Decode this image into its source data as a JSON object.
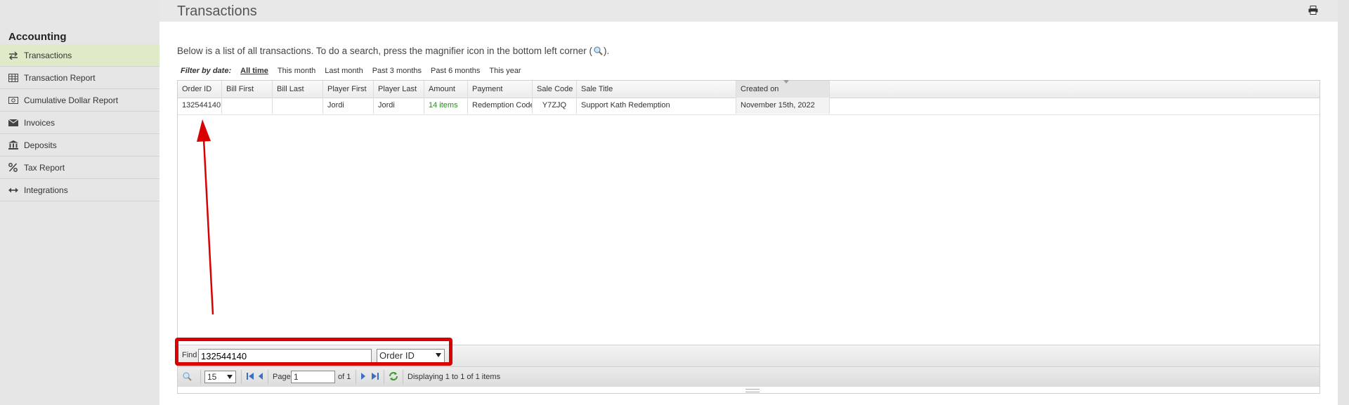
{
  "sidebar": {
    "heading": "Accounting",
    "items": [
      {
        "label": "Transactions",
        "icon": "arrows-exchange-icon",
        "active": true
      },
      {
        "label": "Transaction Report",
        "icon": "table-icon"
      },
      {
        "label": "Cumulative Dollar Report",
        "icon": "money-icon"
      },
      {
        "label": "Invoices",
        "icon": "envelope-icon"
      },
      {
        "label": "Deposits",
        "icon": "bank-icon"
      },
      {
        "label": "Tax Report",
        "icon": "percent-icon"
      },
      {
        "label": "Integrations",
        "icon": "arrows-horizontal-icon"
      }
    ]
  },
  "header": {
    "title": "Transactions",
    "print_icon": "print-icon"
  },
  "intro": {
    "text_before": "Below is a list of all transactions. To do a search, press the magnifier icon in the bottom left corner (",
    "text_after": ")."
  },
  "filter": {
    "label": "Filter by date:",
    "options": [
      "All time",
      "This month",
      "Last month",
      "Past 3 months",
      "Past 6 months",
      "This year"
    ],
    "selected": "All time"
  },
  "table": {
    "columns": [
      "Order ID",
      "Bill First",
      "Bill Last",
      "Player First",
      "Player Last",
      "Amount",
      "Payment",
      "Sale Code",
      "Sale Title",
      "Created on"
    ],
    "rows": [
      [
        "132544140",
        "",
        "",
        "Jordi",
        "Jordi",
        "14 items",
        "Redemption Code",
        "Y7ZJQ",
        "Support Kath Redemption",
        "November 15th, 2022"
      ]
    ]
  },
  "find": {
    "label": "Find",
    "value": "132544140",
    "field": "Order ID"
  },
  "pager": {
    "per_page": "15",
    "page_label": "Page",
    "page_value": "1",
    "of_label": "of 1",
    "status": "Displaying 1 to 1 of 1 items"
  },
  "colors": {
    "annotation": "#d80000",
    "active_nav": "#dfeac8",
    "amount_green": "#2b8a1f"
  }
}
